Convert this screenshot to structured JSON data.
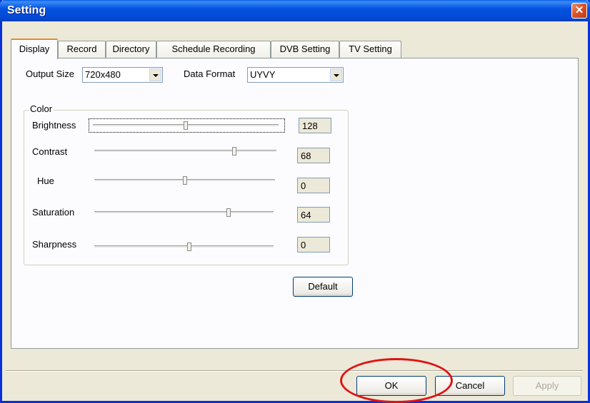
{
  "window": {
    "title": "Setting",
    "close_glyph": "✕",
    "icon": "close-icon"
  },
  "tabs": [
    {
      "label": "Display",
      "active": true
    },
    {
      "label": "Record",
      "active": false
    },
    {
      "label": "Directory",
      "active": false
    },
    {
      "label": "Schedule Recording",
      "active": false
    },
    {
      "label": "DVB Setting",
      "active": false
    },
    {
      "label": "TV Setting",
      "active": false
    }
  ],
  "display": {
    "output_size": {
      "label": "Output Size",
      "value": "720x480"
    },
    "data_format": {
      "label": "Data Format",
      "value": "UYVY"
    },
    "color_group": {
      "title": "Color",
      "sliders": [
        {
          "label": "Brightness",
          "value": "128",
          "level": 0.5
        },
        {
          "label": "Contrast",
          "value": "68",
          "level": 0.77
        },
        {
          "label": "Hue",
          "value": "0",
          "level": 0.5
        },
        {
          "label": "Saturation",
          "value": "64",
          "level": 0.75
        },
        {
          "label": "Sharpness",
          "value": "0",
          "level": 0.53
        }
      ]
    },
    "default_button": "Default"
  },
  "footer": {
    "ok_label": "OK",
    "cancel_label": "Cancel",
    "apply_label": "Apply",
    "apply_enabled": false
  },
  "annotation": {
    "highlight_color": "#e01313",
    "target": "ok-button"
  }
}
